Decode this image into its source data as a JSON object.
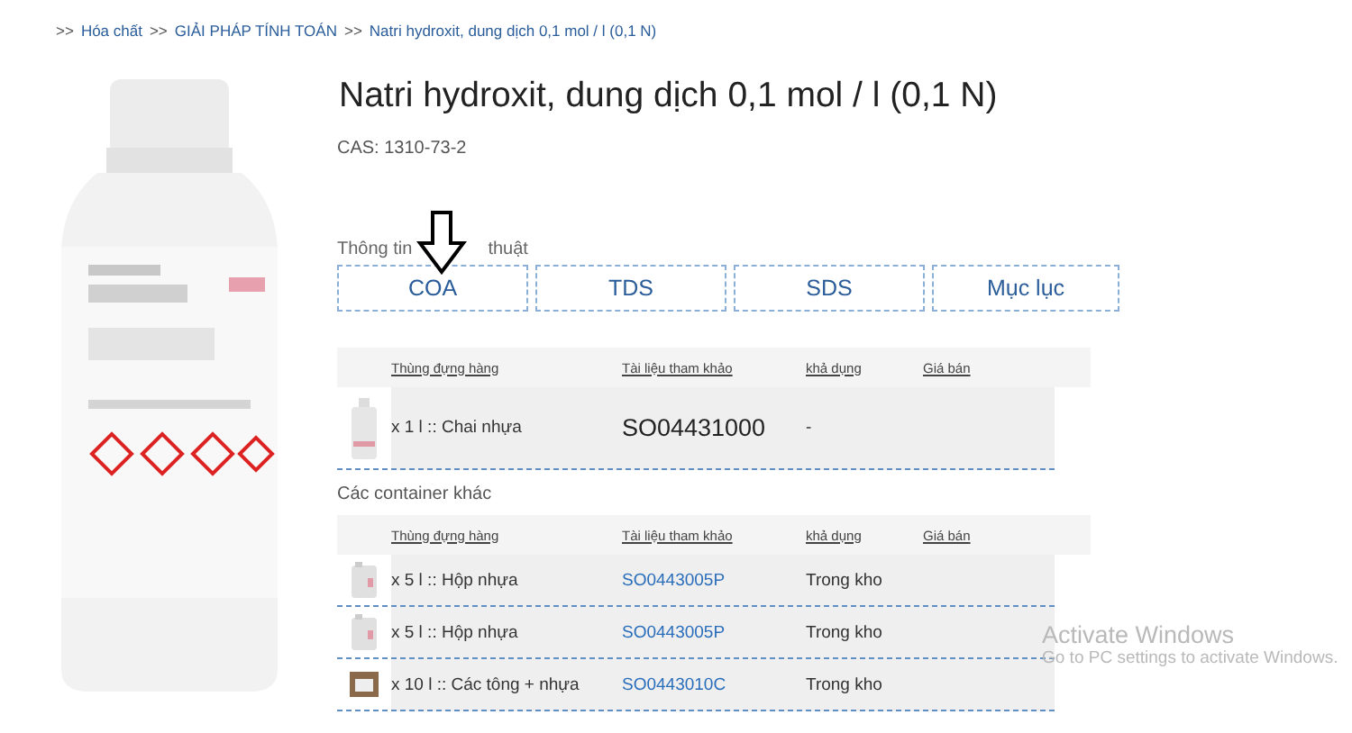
{
  "breadcrumb": [
    {
      "kind": "sep",
      "text": ">>"
    },
    {
      "kind": "link",
      "text": "Hóa chất"
    },
    {
      "kind": "sep",
      "text": ">>"
    },
    {
      "kind": "link",
      "text": "GIẢI PHÁP TÍNH TOÁN"
    },
    {
      "kind": "sep",
      "text": ">>"
    },
    {
      "kind": "link",
      "text": "Natri hydroxit, dung dịch 0,1 mol / l (0,1 N)"
    }
  ],
  "product": {
    "title": "Natri hydroxit, dung dịch 0,1 mol / l (0,1 N)",
    "cas": "CAS: 1310-73-2"
  },
  "tech_info": {
    "heading_parts": [
      "Thông tin",
      "thuật"
    ],
    "buttons": [
      "COA",
      "TDS",
      "SDS",
      "Mục lục"
    ]
  },
  "main_table": {
    "columns": [
      "Thùng đựng hàng",
      "Tài liệu tham khảo",
      "khả dụng",
      "Giá bán"
    ],
    "rows": [
      {
        "kind": "bottle",
        "container": "x 1 l :: Chai nhựa",
        "reference": "SO04431000",
        "availability": "-"
      }
    ]
  },
  "other_containers": {
    "heading": "Các container khác",
    "columns": [
      "Thùng đựng hàng",
      "Tài liệu tham khảo",
      "khả dụng",
      "Giá bán"
    ],
    "rows": [
      {
        "kind": "canister",
        "container": "x 5 l :: Hộp nhựa",
        "reference": "SO0443005P",
        "availability": "Trong kho"
      },
      {
        "kind": "canister",
        "container": "x 5 l :: Hộp nhựa",
        "reference": "SO0443005P",
        "availability": "Trong kho"
      },
      {
        "kind": "box",
        "container": "x 10 l :: Các tông + nhựa",
        "reference": "SO0443010C",
        "availability": "Trong kho"
      }
    ]
  },
  "os_notice": {
    "title": "Activate Windows",
    "text": "Go to PC settings to activate Windows."
  }
}
